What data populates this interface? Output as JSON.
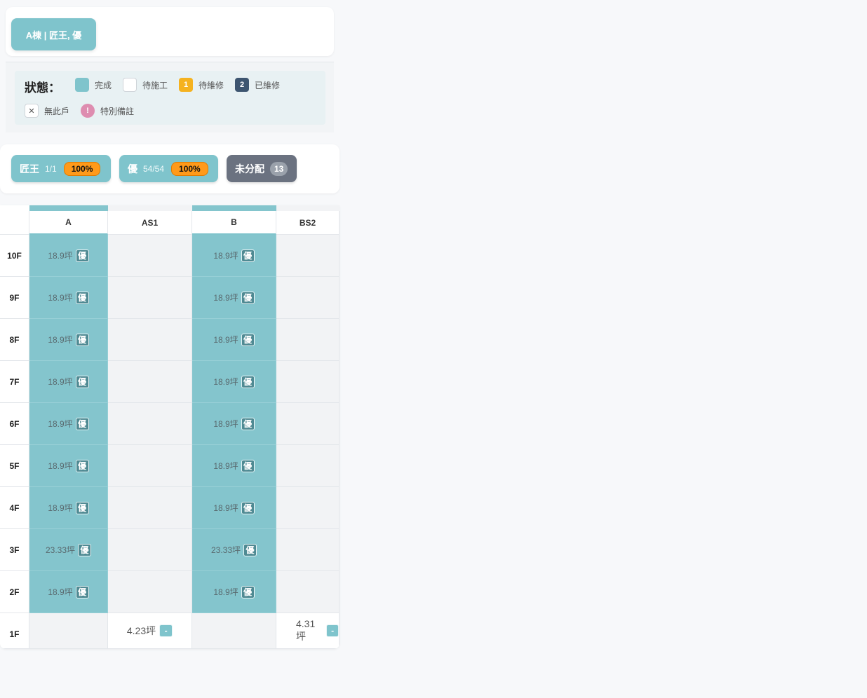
{
  "building_tab": "A棟 | 匠王, 優",
  "legend": {
    "title": "狀態：",
    "items": [
      {
        "label": "完成",
        "color": "#7fc4cc",
        "mark": ""
      },
      {
        "label": "待施工",
        "color": "#ffffff",
        "mark": ""
      },
      {
        "label": "待維修",
        "color": "#f5b21f",
        "mark": "1"
      },
      {
        "label": "已維修",
        "color": "#3d5570",
        "mark": "2"
      },
      {
        "label": "無此戶",
        "color": "#ffffff",
        "mark": "✕"
      },
      {
        "label": "特別備註",
        "color": "#de8db0",
        "mark": "!"
      }
    ]
  },
  "workers": [
    {
      "name": "匠王",
      "count": "1/1",
      "percent": "100%"
    },
    {
      "name": "優",
      "count": "54/54",
      "percent": "100%"
    }
  ],
  "unassigned": {
    "label": "未分配",
    "count": "13"
  },
  "grid": {
    "columns": [
      "A",
      "AS1",
      "B",
      "BS2"
    ],
    "rows": [
      {
        "floor": "10F",
        "cells": [
          {
            "area": "18.9坪",
            "tag": "優"
          },
          null,
          {
            "area": "18.9坪",
            "tag": "優"
          },
          null
        ]
      },
      {
        "floor": "9F",
        "cells": [
          {
            "area": "18.9坪",
            "tag": "優"
          },
          null,
          {
            "area": "18.9坪",
            "tag": "優"
          },
          null
        ]
      },
      {
        "floor": "8F",
        "cells": [
          {
            "area": "18.9坪",
            "tag": "優"
          },
          null,
          {
            "area": "18.9坪",
            "tag": "優"
          },
          null
        ]
      },
      {
        "floor": "7F",
        "cells": [
          {
            "area": "18.9坪",
            "tag": "優"
          },
          null,
          {
            "area": "18.9坪",
            "tag": "優"
          },
          null
        ]
      },
      {
        "floor": "6F",
        "cells": [
          {
            "area": "18.9坪",
            "tag": "優"
          },
          null,
          {
            "area": "18.9坪",
            "tag": "優"
          },
          null
        ]
      },
      {
        "floor": "5F",
        "cells": [
          {
            "area": "18.9坪",
            "tag": "優"
          },
          null,
          {
            "area": "18.9坪",
            "tag": "優"
          },
          null
        ]
      },
      {
        "floor": "4F",
        "cells": [
          {
            "area": "18.9坪",
            "tag": "優"
          },
          null,
          {
            "area": "18.9坪",
            "tag": "優"
          },
          null
        ]
      },
      {
        "floor": "3F",
        "cells": [
          {
            "area": "23.33坪",
            "tag": "優"
          },
          null,
          {
            "area": "23.33坪",
            "tag": "優"
          },
          null
        ]
      },
      {
        "floor": "2F",
        "cells": [
          {
            "area": "18.9坪",
            "tag": "優"
          },
          null,
          {
            "area": "18.9坪",
            "tag": "優"
          },
          null
        ]
      },
      {
        "floor": "1F",
        "cells": [
          null,
          {
            "area": "4.23坪",
            "tag": "-"
          },
          null,
          {
            "area": "4.31坪",
            "tag": "-"
          }
        ]
      }
    ]
  }
}
